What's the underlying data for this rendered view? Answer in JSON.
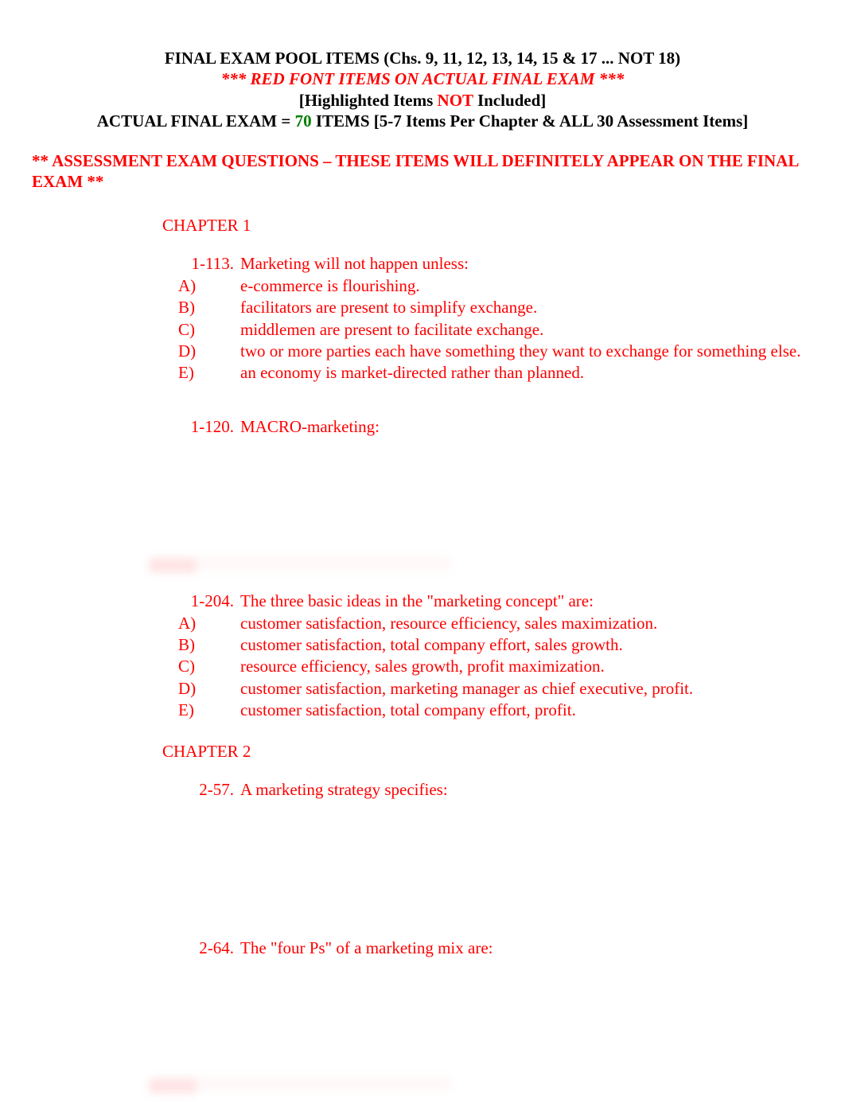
{
  "header": {
    "line1_a": "FINAL EXAM POOL ITEMS (Chs. 9, 11, 12, 13, 14, 15 & 17 ... NOT 18)",
    "line2": "*** RED FONT ITEMS ON ACTUAL FINAL EXAM ***",
    "line3_a": "[Highlighted Items ",
    "line3_b": "NOT",
    "line3_c": " Included]",
    "line4_a": "ACTUAL FINAL EXAM = ",
    "line4_b": "70",
    "line4_c": " ITEMS [5-7 Items Per Chapter & ALL 30 Assessment Items]"
  },
  "assessment": "** ASSESSMENT EXAM QUESTIONS – THESE ITEMS WILL DEFINITELY APPEAR ON THE FINAL EXAM **",
  "chapters": [
    {
      "label": "CHAPTER 1"
    },
    {
      "label": "CHAPTER 2"
    }
  ],
  "questions": {
    "q1_113": {
      "num": "1-113.",
      "stem": "Marketing will not happen unless:",
      "options": [
        {
          "label": "A)",
          "text": "e-commerce is flourishing."
        },
        {
          "label": "B)",
          "text": "facilitators are present to simplify exchange."
        },
        {
          "label": "C)",
          "text": "middlemen are present to facilitate exchange."
        },
        {
          "label": "D)",
          "text": "two or more parties each have something they want to exchange for something else."
        },
        {
          "label": "E)",
          "text": "an economy is market-directed rather than planned."
        }
      ]
    },
    "q1_120": {
      "num": "1-120.",
      "stem": "MACRO-marketing:"
    },
    "q1_204": {
      "num": "1-204.",
      "stem": "The three basic ideas in the \"marketing concept\" are:",
      "options": [
        {
          "label": "A)",
          "text": "customer satisfaction, resource efficiency, sales maximization."
        },
        {
          "label": "B)",
          "text": "customer satisfaction, total company effort, sales growth."
        },
        {
          "label": "C)",
          "text": "resource efficiency, sales growth, profit maximization."
        },
        {
          "label": "D)",
          "text": "customer satisfaction, marketing manager as chief executive, profit."
        },
        {
          "label": "E)",
          "text": "customer satisfaction, total company effort, profit."
        }
      ]
    },
    "q2_57": {
      "num": "2-57.",
      "stem": "A marketing strategy specifies:"
    },
    "q2_64": {
      "num": "2-64.",
      "stem": "The \"four Ps\" of a marketing mix are:"
    }
  }
}
